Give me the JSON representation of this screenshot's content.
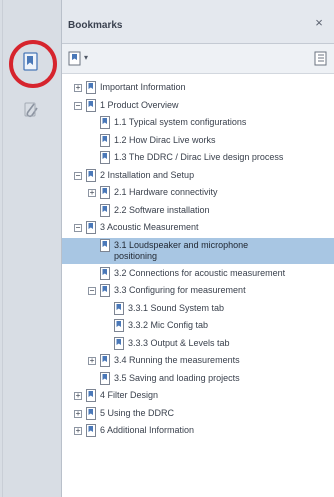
{
  "panel": {
    "title": "Bookmarks"
  },
  "icons": {
    "bookmark": "bookmark-icon",
    "options": "options-icon",
    "close": "close-icon",
    "expand": "expand-all-icon",
    "attachment": "attachment-icon"
  },
  "colors": {
    "highlight_circle": "#d6242d",
    "selected_row": "#a8c6e3",
    "bookmark_icon": "#4a78b8"
  },
  "tree": {
    "items": [
      {
        "label": "Important Information",
        "level": 0,
        "expanded": false,
        "has_children": true
      },
      {
        "label": "1 Product Overview",
        "level": 0,
        "expanded": true,
        "has_children": true
      },
      {
        "label": "1.1 Typical system configurations",
        "level": 1,
        "has_children": false
      },
      {
        "label": "1.2 How Dirac Live works",
        "level": 1,
        "has_children": false
      },
      {
        "label": "1.3 The DDRC / Dirac Live design process",
        "level": 1,
        "has_children": false
      },
      {
        "label": "2 Installation and Setup",
        "level": 0,
        "expanded": true,
        "has_children": true
      },
      {
        "label": "2.1 Hardware connectivity",
        "level": 1,
        "expanded": false,
        "has_children": true
      },
      {
        "label": "2.2 Software installation",
        "level": 1,
        "has_children": false
      },
      {
        "label": "3 Acoustic Measurement",
        "level": 0,
        "expanded": true,
        "has_children": true
      },
      {
        "label": "3.1 Loudspeaker and microphone positioning",
        "level": 1,
        "has_children": false,
        "selected": true
      },
      {
        "label": "3.2 Connections for acoustic measurement",
        "level": 1,
        "has_children": false
      },
      {
        "label": "3.3 Configuring for measurement",
        "level": 1,
        "expanded": true,
        "has_children": true
      },
      {
        "label": "3.3.1 Sound System tab",
        "level": 2,
        "has_children": false
      },
      {
        "label": "3.3.2 Mic Config tab",
        "level": 2,
        "has_children": false
      },
      {
        "label": "3.3.3 Output & Levels tab",
        "level": 2,
        "has_children": false
      },
      {
        "label": "3.4 Running the measurements",
        "level": 1,
        "expanded": false,
        "has_children": true
      },
      {
        "label": "3.5 Saving and loading projects",
        "level": 1,
        "has_children": false
      },
      {
        "label": "4 Filter Design",
        "level": 0,
        "expanded": false,
        "has_children": true
      },
      {
        "label": "5 Using the DDRC",
        "level": 0,
        "expanded": false,
        "has_children": true
      },
      {
        "label": "6 Additional Information",
        "level": 0,
        "expanded": false,
        "has_children": true
      }
    ]
  }
}
